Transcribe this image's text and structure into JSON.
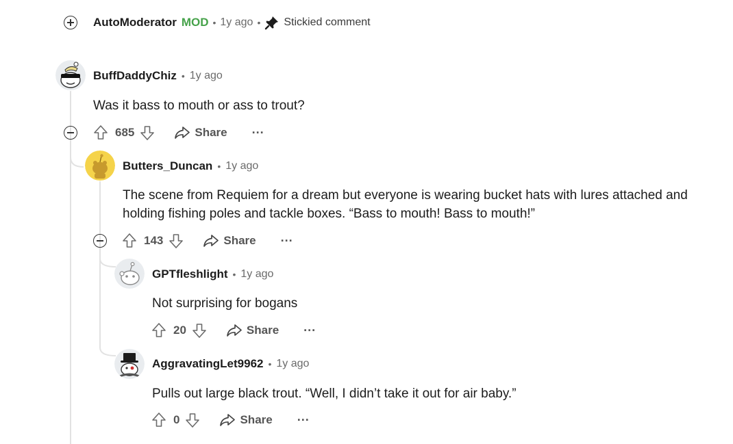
{
  "colors": {
    "mod_green": "#46a24a",
    "meta_gray": "#6a6a6a",
    "thread_line": "#e2e2e2"
  },
  "sticky": {
    "author": "AutoModerator",
    "mod_badge": "MOD",
    "time": "1y ago",
    "sticky_label": "Stickied comment",
    "icons": {
      "expand": "plus-circle-icon",
      "pin": "pin-icon"
    }
  },
  "comments": [
    {
      "author": "BuffDaddyChiz",
      "time": "1y ago",
      "text": "Was it bass to mouth or ass to trout?",
      "votes": "685",
      "share": "Share",
      "more": "···",
      "avatar": "snoo-sunglasses-avatar"
    },
    {
      "author": "Butters_Duncan",
      "time": "1y ago",
      "text": "The scene from Requiem for a dream but everyone is wearing bucket hats with lures attached and holding fishing poles and tackle boxes. “Bass to mouth! Bass to mouth!”",
      "votes": "143",
      "share": "Share",
      "more": "···",
      "avatar": "snoo-yellow-avatar"
    },
    {
      "author": "GPTfleshlight",
      "time": "1y ago",
      "text": "Not surprising for bogans",
      "votes": "20",
      "share": "Share",
      "more": "···",
      "avatar": "snoo-default-avatar"
    },
    {
      "author": "AggravatingLet9962",
      "time": "1y ago",
      "text": "Pulls out large black trout. “Well, I didn’t take it out for air baby.”",
      "votes": "0",
      "share": "Share",
      "more": "···",
      "avatar": "snoo-tophat-avatar"
    }
  ]
}
